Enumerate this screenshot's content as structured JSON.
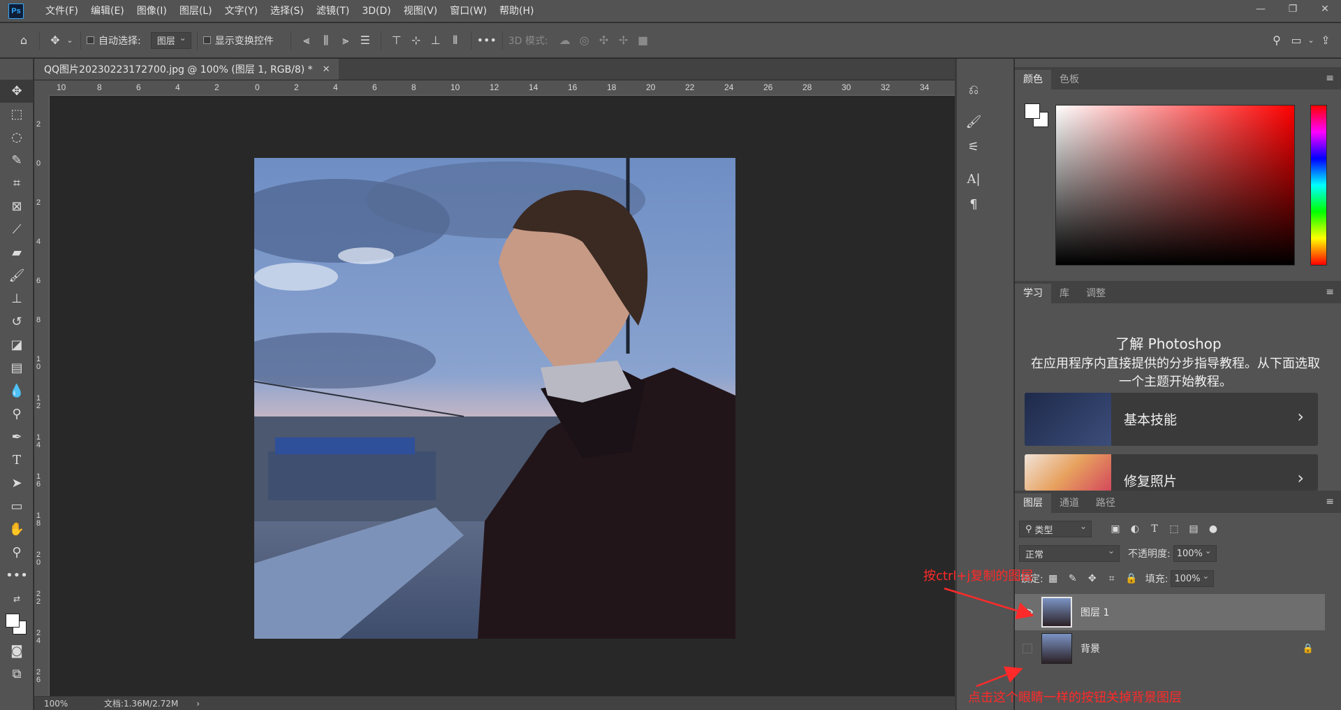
{
  "app": {
    "logo": "Ps",
    "menu": [
      "文件(F)",
      "编辑(E)",
      "图像(I)",
      "图层(L)",
      "文字(Y)",
      "选择(S)",
      "滤镜(T)",
      "3D(D)",
      "视图(V)",
      "窗口(W)",
      "帮助(H)"
    ],
    "window_controls": [
      "minimize-icon",
      "restore-icon",
      "close-icon"
    ]
  },
  "options": {
    "auto_select_label": "自动选择:",
    "auto_select_value": "图层",
    "show_transform_label": "显示变换控件",
    "mode_3d_label": "3D 模式:"
  },
  "document": {
    "tab_title": "QQ图片20230223172700.jpg @ 100% (图层 1, RGB/8) *",
    "zoom": "100%",
    "doc_info": "文档:1.36M/2.72M"
  },
  "rulers": {
    "top": [
      "10",
      "8",
      "6",
      "4",
      "2",
      "0",
      "2",
      "4",
      "6",
      "8",
      "10",
      "12",
      "14",
      "16",
      "18",
      "20",
      "22",
      "24",
      "26",
      "28",
      "30",
      "32",
      "34"
    ],
    "left": [
      "2",
      "0",
      "2",
      "4",
      "6",
      "8",
      "10",
      "12",
      "14",
      "16",
      "18",
      "20",
      "22",
      "24",
      "26"
    ]
  },
  "panels": {
    "color_tabs": [
      "颜色",
      "色板"
    ],
    "learn_tabs": [
      "学习",
      "库",
      "调整"
    ],
    "learn_title": "了解 Photoshop",
    "learn_desc": "在应用程序内直接提供的分步指导教程。从下面选取一个主题开始教程。",
    "learn_cards": [
      "基本技能",
      "修复照片"
    ],
    "layers_tabs": [
      "图层",
      "通道",
      "路径"
    ],
    "filter_kind": "类型",
    "blend_mode": "正常",
    "opacity_label": "不透明度:",
    "opacity_value": "100%",
    "lock_label": "锁定:",
    "fill_label": "填充:",
    "fill_value": "100%",
    "layers": [
      {
        "name": "图层 1",
        "visible": true,
        "selected": true
      },
      {
        "name": "背景",
        "visible": false,
        "selected": false,
        "locked": true
      }
    ]
  },
  "annotations": {
    "top": "按ctrl+j复制的图层",
    "bottom": "点击这个眼睛一样的按钮关掉背景图层"
  },
  "colors": {
    "annotation": "#ff2a2a",
    "ps_blue": "#31a8ff"
  }
}
